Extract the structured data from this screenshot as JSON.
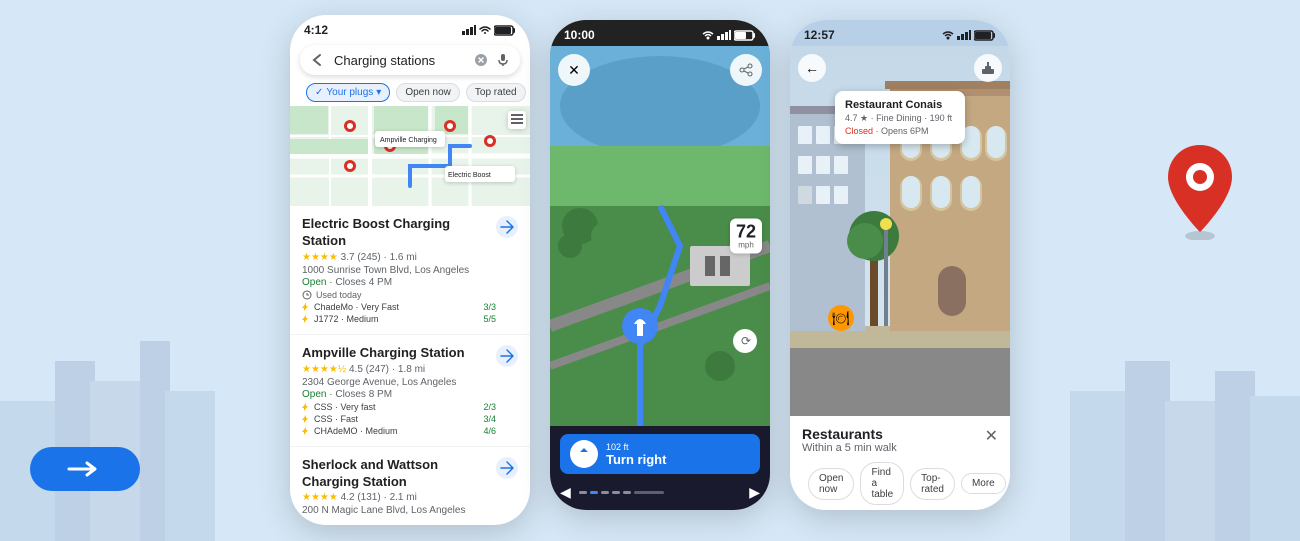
{
  "background": {
    "color": "#d6e8f7"
  },
  "phone1": {
    "status_bar": {
      "time": "4:12",
      "signal": "▲▲▲",
      "wifi": "WiFi",
      "battery": "🔋"
    },
    "search": {
      "placeholder": "Charging stations",
      "text": "Charging stations"
    },
    "filters": [
      {
        "label": "⚙",
        "type": "icon"
      },
      {
        "label": "✓ Your plugs ▾",
        "type": "active"
      },
      {
        "label": "Open now",
        "type": "plain"
      },
      {
        "label": "Top rated",
        "type": "plain"
      }
    ],
    "listings": [
      {
        "title": "Electric Boost Charging Station",
        "rating": "3.7",
        "review_count": "(245)",
        "distance": "1.6 mi",
        "address": "1000 Sunrise Town Blvd, Los Angeles",
        "status": "Open",
        "closes": "Closes 4 PM",
        "used": "Used today",
        "chargers": [
          {
            "name": "ChadeMo",
            "speed": "Very Fast",
            "count": "3/3",
            "color": "green"
          },
          {
            "name": "J1772",
            "speed": "Medium",
            "count": "5/5",
            "color": "green"
          }
        ]
      },
      {
        "title": "Ampville Charging Station",
        "rating": "4.5",
        "review_count": "(247)",
        "distance": "1.8 mi",
        "address": "2304 George Avenue, Los Angeles",
        "status": "Open",
        "closes": "Closes 8 PM",
        "chargers": [
          {
            "name": "CSS",
            "speed": "Very fast",
            "count": "2/3",
            "color": "green"
          },
          {
            "name": "CSS",
            "speed": "Fast",
            "count": "3/4",
            "color": "green"
          },
          {
            "name": "CHAdeMO",
            "speed": "Medium",
            "count": "4/6",
            "color": "green"
          }
        ]
      },
      {
        "title": "Sherlock and Wattson Charging Station",
        "rating": "4.2",
        "review_count": "(131)",
        "distance": "2.1 mi",
        "address": "200 N Magic Lane Blvd, Los Angeles"
      }
    ]
  },
  "phone2": {
    "status_bar": {
      "time": "10:00"
    },
    "direction": {
      "distance": "102 ft",
      "instruction": "Turn right"
    },
    "speed": "72",
    "nav_controls": {
      "prev": "◀",
      "next": "▶"
    }
  },
  "phone3": {
    "status_bar": {
      "time": "12:57"
    },
    "info_card": {
      "title": "Restaurant Conais",
      "rating": "4.7",
      "type": "Fine Dining",
      "distance": "190 ft",
      "status": "Closed",
      "opens": "Opens 6PM"
    },
    "bottom_panel": {
      "title": "Restaurants",
      "subtitle": "Within a 5 min walk",
      "filters": [
        "Open now",
        "Find a table",
        "Top-rated",
        "More"
      ]
    }
  },
  "blue_arrow": {
    "icon": "→"
  }
}
